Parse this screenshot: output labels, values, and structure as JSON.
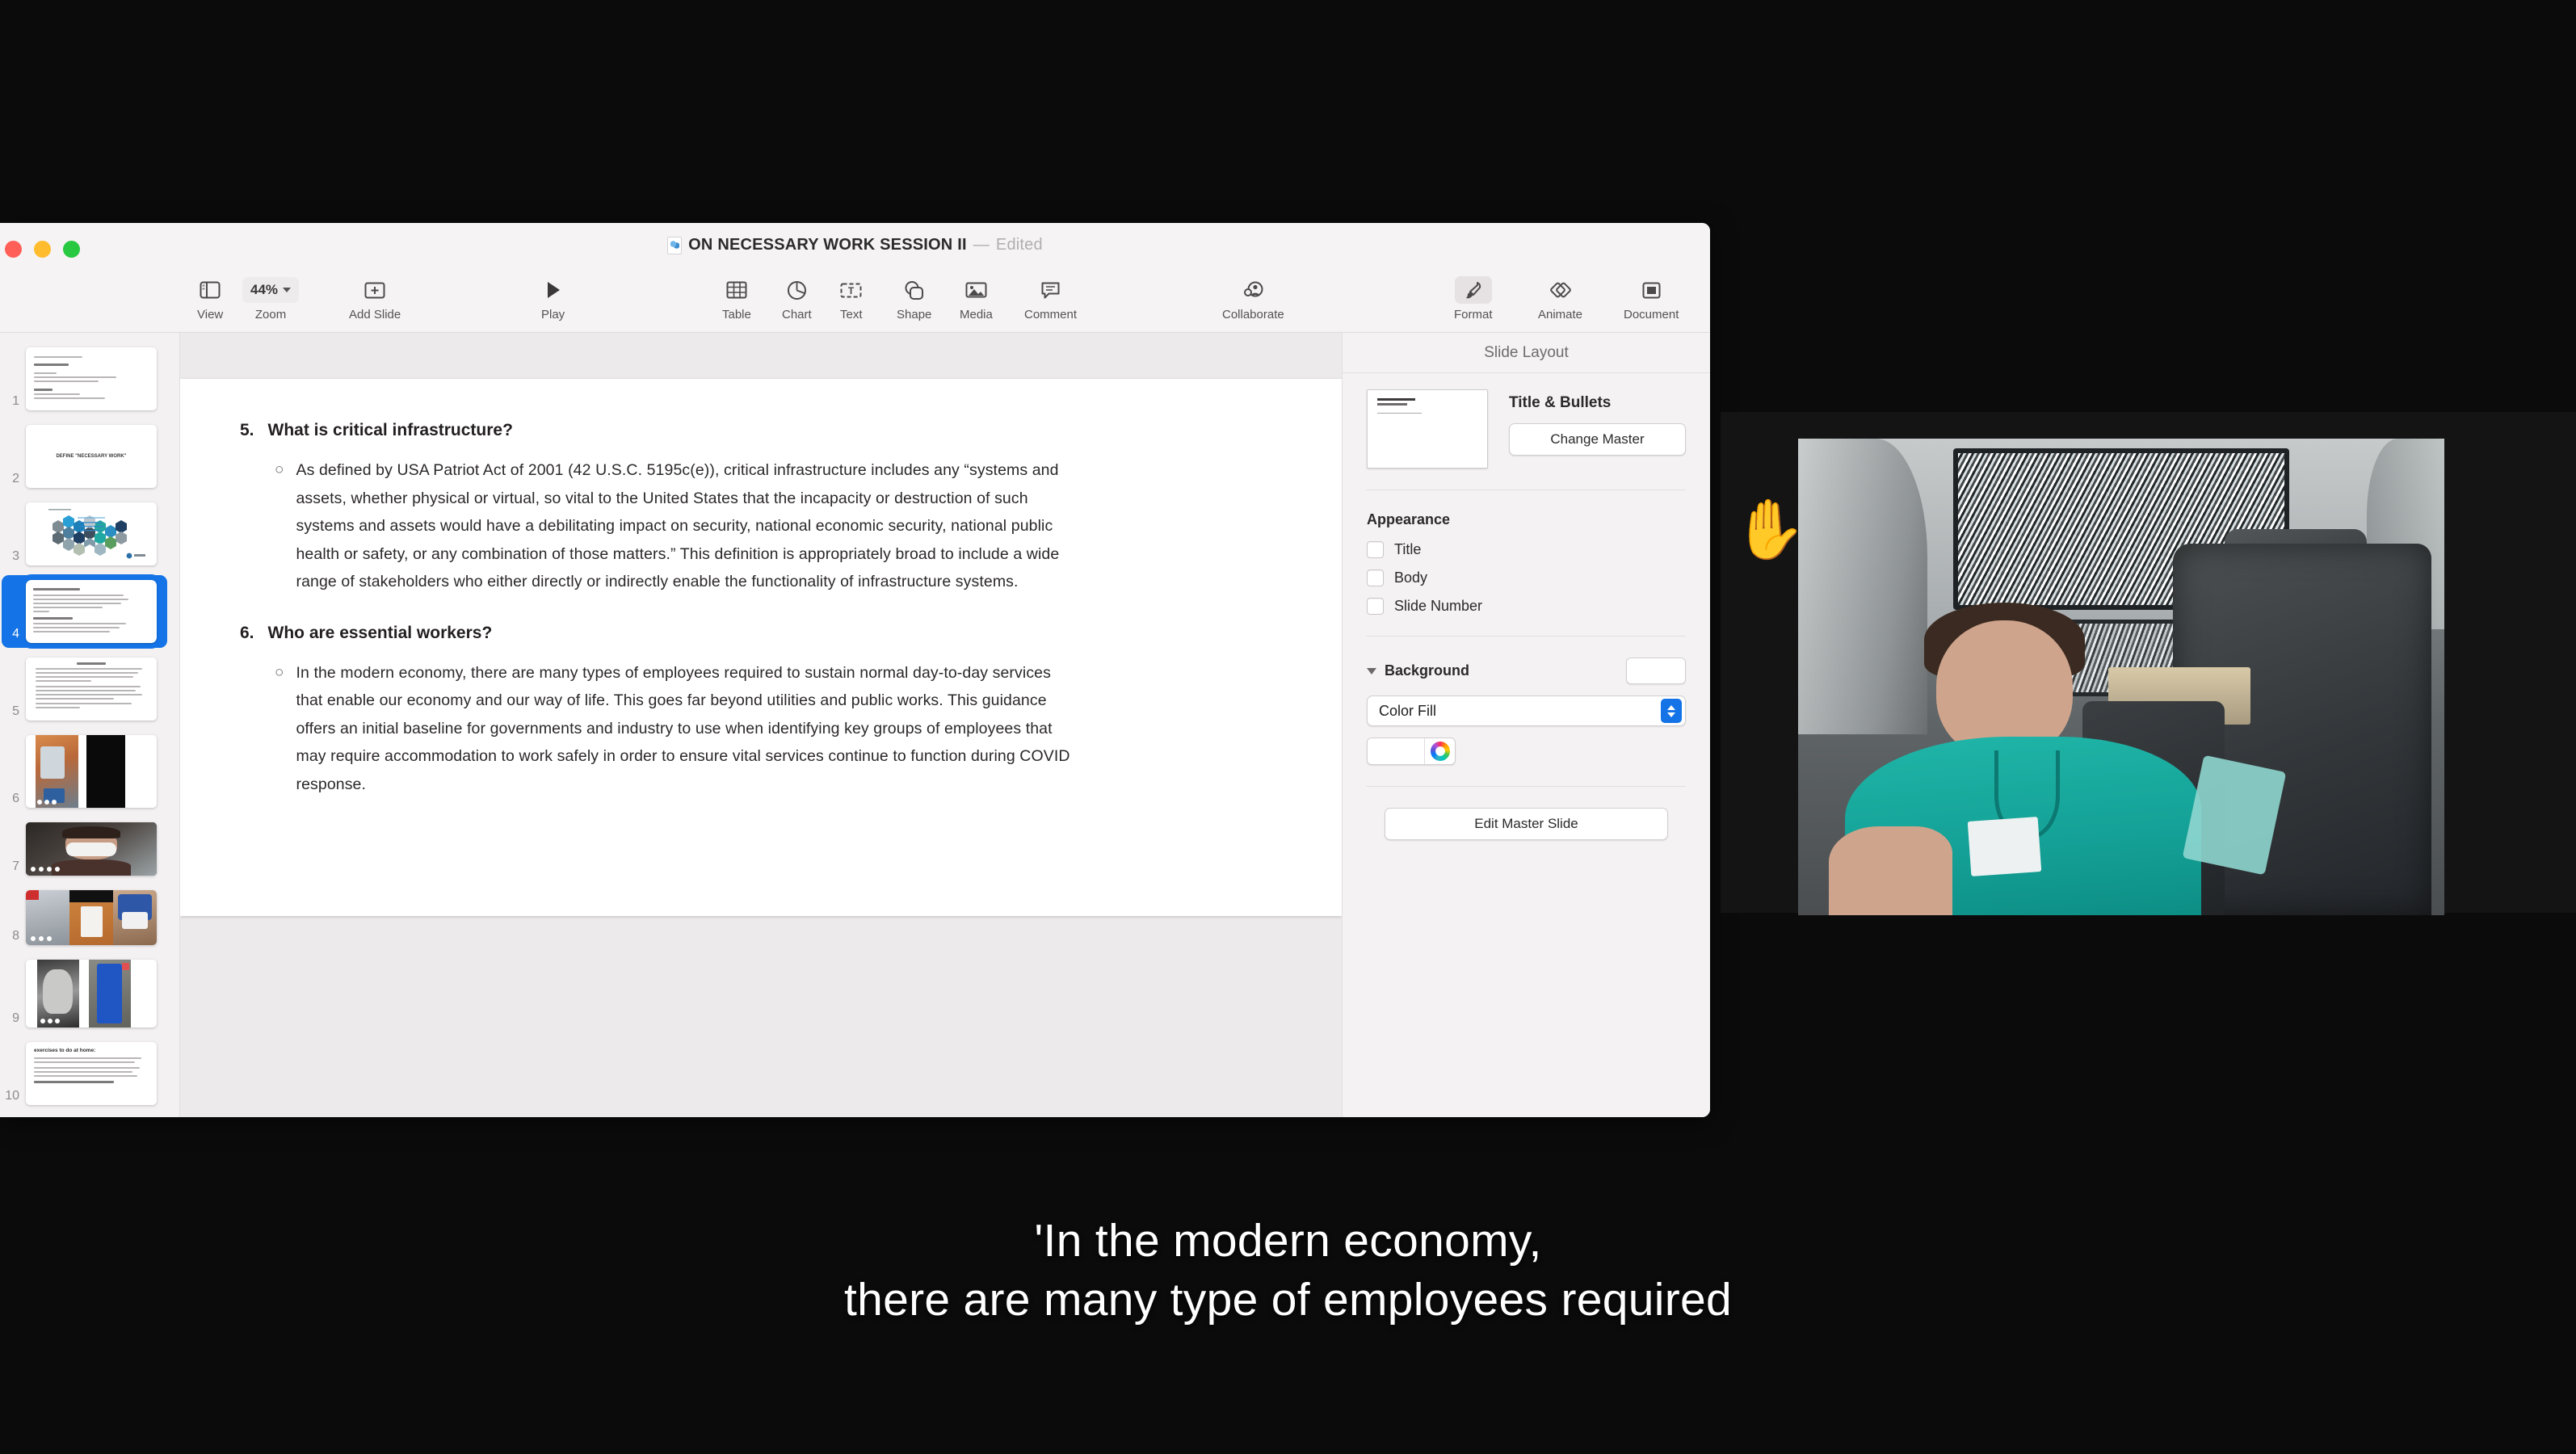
{
  "window": {
    "title": "ON NECESSARY WORK SESSION II",
    "title_separator": "—",
    "edited_label": "Edited"
  },
  "toolbar": {
    "items": [
      {
        "label": "View",
        "icon": "sidebar-icon"
      },
      {
        "label": "Zoom",
        "icon": "zoom-chevron-icon",
        "value": "44%"
      },
      {
        "label": "Add Slide",
        "icon": "plus-box-icon"
      },
      {
        "label": "Play",
        "icon": "play-triangle-icon"
      },
      {
        "label": "Table",
        "icon": "table-grid-icon"
      },
      {
        "label": "Chart",
        "icon": "pie-chart-icon"
      },
      {
        "label": "Text",
        "icon": "text-box-icon"
      },
      {
        "label": "Shape",
        "icon": "shapes-icon"
      },
      {
        "label": "Media",
        "icon": "image-icon"
      },
      {
        "label": "Comment",
        "icon": "comment-bubble-icon"
      },
      {
        "label": "Collaborate",
        "icon": "collaborate-person-icon"
      },
      {
        "label": "Format",
        "icon": "paintbrush-icon",
        "active": true
      },
      {
        "label": "Animate",
        "icon": "diamonds-icon"
      },
      {
        "label": "Document",
        "icon": "document-square-icon"
      }
    ]
  },
  "navigator": {
    "slides": [
      {
        "number": "1",
        "kind": "text"
      },
      {
        "number": "2",
        "kind": "title",
        "title": "DEFINE \"NECESSARY WORK\""
      },
      {
        "number": "3",
        "kind": "hexagons"
      },
      {
        "number": "4",
        "kind": "text",
        "selected": true
      },
      {
        "number": "5",
        "kind": "text"
      },
      {
        "number": "6",
        "kind": "photos2"
      },
      {
        "number": "7",
        "kind": "photo1"
      },
      {
        "number": "8",
        "kind": "photos3"
      },
      {
        "number": "9",
        "kind": "photos2b"
      },
      {
        "number": "10",
        "kind": "text",
        "title": "exercises to do at home:"
      }
    ]
  },
  "slide": {
    "blocks": [
      {
        "number": "5.",
        "heading": "What is critical infrastructure?",
        "bullet": "○",
        "body": "As defined by USA Patriot Act of 2001 (42 U.S.C. 5195c(e)), critical infrastructure includes any “systems and assets, whether physical or virtual, so vital to the United States that the incapacity or destruction of such systems and assets would have a debilitating impact on security, national economic security, national public health or safety, or any combination of those matters.” This definition is appropriately broad to include a wide range of stakeholders who either directly or indirectly enable the functionality of infrastructure systems."
      },
      {
        "number": "6.",
        "heading": "Who are essential workers?",
        "bullet": "○",
        "body": "In the modern economy, there are many types of employees required to sustain normal day-to-day services that enable our economy and our way of life. This goes far beyond utilities and public works. This guidance offers an initial baseline for governments and industry to use when identifying key groups of employees that may require accommodation to work safely in order to ensure vital services continue to function during COVID response."
      }
    ]
  },
  "inspector": {
    "title": "Slide Layout",
    "master_name": "Title & Bullets",
    "change_master_label": "Change Master",
    "appearance_heading": "Appearance",
    "appearance_options": [
      {
        "label": "Title",
        "checked": false
      },
      {
        "label": "Body",
        "checked": false
      },
      {
        "label": "Slide Number",
        "checked": false
      }
    ],
    "background_heading": "Background",
    "background_fill_value": "Color Fill",
    "background_color": "#ffffff",
    "edit_master_label": "Edit Master Slide"
  },
  "video": {
    "reaction_icon": "raised-hand-icon",
    "reaction_glyph": "✋"
  },
  "caption": {
    "line1": "'In the modern economy,",
    "line2": "there are many type of employees required"
  },
  "colors": {
    "accent": "#1473e6",
    "window_chrome": "#f6f3f4",
    "canvas_bg": "#eceaea"
  }
}
